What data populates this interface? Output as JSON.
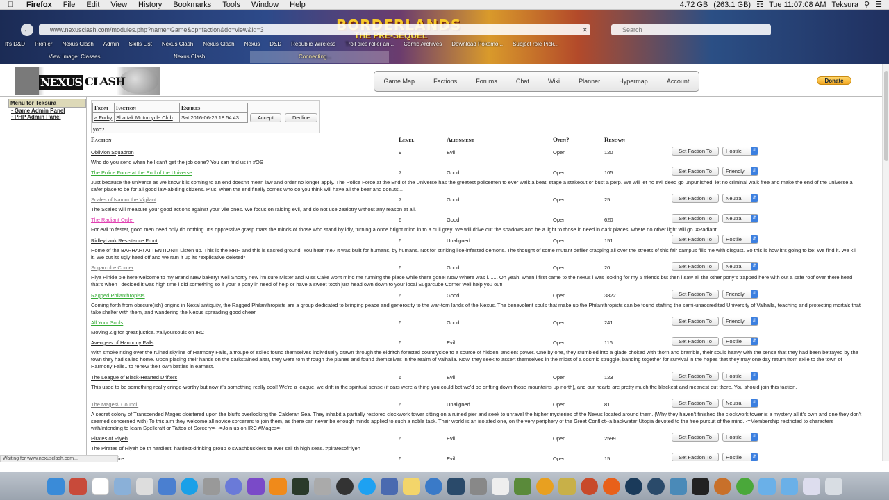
{
  "menubar": {
    "app": "Firefox",
    "items": [
      "File",
      "Edit",
      "View",
      "History",
      "Bookmarks",
      "Tools",
      "Window",
      "Help"
    ],
    "memory": "4.72 GB",
    "memory2": "(263.1 GB)",
    "clock": "Tue 11:07:08 AM",
    "user": "Teksura"
  },
  "browser": {
    "url": "www.nexusclash.com/modules.php?name=Game&op=faction&do=view&id=3",
    "search_placeholder": "Search",
    "banner_title": "BORDERLANDS",
    "banner_sub": "THE PRE-SEQUEL",
    "bookmarks": [
      "It's D&D",
      "Profiler",
      "Nexus Clash",
      "Admin",
      "Skills List",
      "Nexus Clash",
      "Nexus Clash",
      "Nexus",
      "D&D",
      "Republic Wireless",
      "Troll dice roller an...",
      "Comic Archives",
      "Download Pokemo...",
      "Subject role Pick..."
    ],
    "tabs": [
      "View Image: Classes",
      "Nexus Clash",
      "Connecting..."
    ]
  },
  "site": {
    "logo_word1": "NEXUS",
    "logo_word2": "CLASH",
    "nav": [
      "Game Map",
      "Factions",
      "Forums",
      "Chat",
      "Wiki",
      "Planner",
      "Hypermap",
      "Account"
    ],
    "donate": "Donate"
  },
  "sidebar": {
    "header": "Menu for Teksura",
    "links": [
      "Game Admin Panel",
      "PHP Admin Panel"
    ]
  },
  "invite": {
    "headers": [
      "From",
      "Faction",
      "Expires"
    ],
    "from": "a Furby",
    "faction": "Shartak Motorcycle Club",
    "expires": "Sat 2016-06-25 18:54:43",
    "accept": "Accept",
    "decline": "Decline",
    "message": "yoo?"
  },
  "table_headers": {
    "faction": "Faction",
    "level": "Level",
    "alignment": "Alignment",
    "open": "Open?",
    "renown": "Renown"
  },
  "set_faction_label": "Set Faction To",
  "factions": [
    {
      "name": "Oblivion Squadron",
      "level": "9",
      "alignment": "Evil",
      "open": "Open",
      "renown": "120",
      "stance": "Hostile",
      "color": "#222222",
      "desc": "Who do you send when hell can't get the job done? You can find us in #OS"
    },
    {
      "name": "The Police Force at the End of the Universe",
      "level": "7",
      "alignment": "Good",
      "open": "Open",
      "renown": "105",
      "stance": "Friendly",
      "color": "#33aa33",
      "desc": "Just because the universe as we know it is coming to an end doesn't mean law and order no longer apply. The Police Force at the End of the Universe has the greatest policemen to ever walk a beat, stage a stakeout or bust a perp. We will let no evil deed go unpunished, let no criminal walk free and make the end of the universe a safer place to be for all good law-abiding citizens. Plus, when the end finally comes who do you think will have all the beer and donuts..."
    },
    {
      "name": "Scales of Namm the Vigilant",
      "level": "7",
      "alignment": "Good",
      "open": "Open",
      "renown": "25",
      "stance": "Neutral",
      "color": "#777777",
      "desc": "The Scales will measure your good actions against your vile ones. We focus on raiding evil, and do not use zealotry without any reason at all."
    },
    {
      "name": "The Radiant Order",
      "level": "6",
      "alignment": "Good",
      "open": "Open",
      "renown": "620",
      "stance": "Neutral",
      "color": "#e040b0",
      "desc": "For evil to fester, good men need only do nothing. It's oppressive grasp mars the minds of those who stand by idly, turning a once bright mind in to a dull grey. We will drive out the shadows and be a light to those in need in dark places, where no other light will go. #Radiant"
    },
    {
      "name": "Ridleybank Resistance Front",
      "level": "6",
      "alignment": "Unaligned",
      "open": "Open",
      "renown": "151",
      "stance": "Hostile",
      "color": "#222222",
      "desc": "Home of the BARHAH! ATTENTION!!! Listen up. This is the RRF, and this is sacred ground. You hear me? It was built for humans, by humans. Not for stinking lice-infested demons. The thought of some mutant defiler crapping all over the streets of this fair campus fills me with disgust. So this is how it\"s going to be: We find it. We kill it. We cut its ugly head off and we ram it up its *explicative deleted*"
    },
    {
      "name": "Sugarcube Corner",
      "level": "6",
      "alignment": "Good",
      "open": "Open",
      "renown": "20",
      "stance": "Neutral",
      "color": "#777777",
      "desc": "Hiya Pinkie pie here welcome to my Brand New bakery! well Shortly new i'm sure Mister and Miss Cake wont mind me running the place while there gone! Now Where was i....... Oh yeah! when i first came to the nexus i was looking for my 5 friends but then i saw all the other pony's trapped here with out a safe roof over there head that's when i decided it was high time i did something so if your a pony in need of help or have a sweet tooth just head own down to your local Sugarcube Corner well help you out!"
    },
    {
      "name": "Ragged Philanthropists",
      "level": "6",
      "alignment": "Good",
      "open": "Open",
      "renown": "3822",
      "stance": "Friendly",
      "color": "#33aa33",
      "desc": "Coming forth from obscure(ish) origins in Nexal antiquity, the Ragged Philanthropists are a group dedicated to bringing peace and generosity to the war-torn lands of the Nexus. The benevolent souls that make up the Philanthropists can be found staffing the semi-unaccredited University of Valhalla, teaching and protecting mortals that take shelter with them, and wandering the Nexus spreading good cheer."
    },
    {
      "name": "All Your Souls",
      "level": "6",
      "alignment": "Good",
      "open": "Open",
      "renown": "241",
      "stance": "Friendly",
      "color": "#33aa33",
      "desc": "Moving Zig for great justice. #allyoursouls on IRC"
    },
    {
      "name": "Avengers of Harmony Falls",
      "level": "6",
      "alignment": "Evil",
      "open": "Open",
      "renown": "116",
      "stance": "Hostile",
      "color": "#222222",
      "desc": "With smoke rising over the ruined skyline of Harmony Falls, a troupe of exiles found themselves individually drawn through the eldritch forested countryside to a source of hidden, ancient power. One by one, they stumbled into a glade choked with thorn and bramble, their souls heavy with the sense that they had been betrayed by the town they had called home. Upon placing their hands on the darkstained altar, they were torn through the planes and found themselves in the realm of Valhalla. Now, they seek to assert themselves in the midst of a cosmic struggle, banding together for survival in the hopes that they may one day return from exile to the town of Harmony Falls...to renew their own battles in earnest."
    },
    {
      "name": "The League of Black-Hearted Drifters",
      "level": "6",
      "alignment": "Evil",
      "open": "Open",
      "renown": "123",
      "stance": "Hostile",
      "color": "#222222",
      "desc": "This used to be something really cringe-worthy but now it's something really cool! We're a league, we drift in the spiritual sense (if cars were a thing you could bet we'd be drifting down those mountains up north), and our hearts are pretty much the blackest and meanest out there. You should join this faction."
    },
    {
      "name": "The Mages\\' Council",
      "level": "6",
      "alignment": "Unaligned",
      "open": "Open",
      "renown": "81",
      "stance": "Neutral",
      "color": "#777777",
      "desc": "A secret colony of Transcended Mages cloistered upon the bluffs overlooking the Calderan Sea. They inhabit a partially restored clockwork tower sitting on a ruined pier and seek to unravel the higher mysteries of the Nexus located around them. (Why they haven't finished the clockwork tower is a mystery all it's own and one they don't seemed concerned with) To this aim they welcome all novice sorcerers to join them, as there can never be enough minds applied to such a noble task. Their world is an isolated one, on the very periphery of the Great Conflict--a backwater Utopia devoted to the free pursuit of the mind. -=Membership restricted to characters with/intending to learn Spellcraft or Tattoo of Sorcery=- -=Join us on IRC #Mages=-"
    },
    {
      "name": "Pirates of Rlyeh",
      "level": "6",
      "alignment": "Evil",
      "open": "Open",
      "renown": "2599",
      "stance": "Hostile",
      "color": "#222222",
      "desc": "The Pirates of Rlyeh be th hardiest, hardest-drinking group o swashbucklers ta ever sail th high seas. #piratesofr'lyeh"
    },
    {
      "name": "...ectic Empire",
      "level": "6",
      "alignment": "Evil",
      "open": "Open",
      "renown": "15",
      "stance": "Hostile",
      "color": "#222222",
      "desc": ""
    }
  ],
  "status_text": "Waiting for www.nexusclash.com..."
}
